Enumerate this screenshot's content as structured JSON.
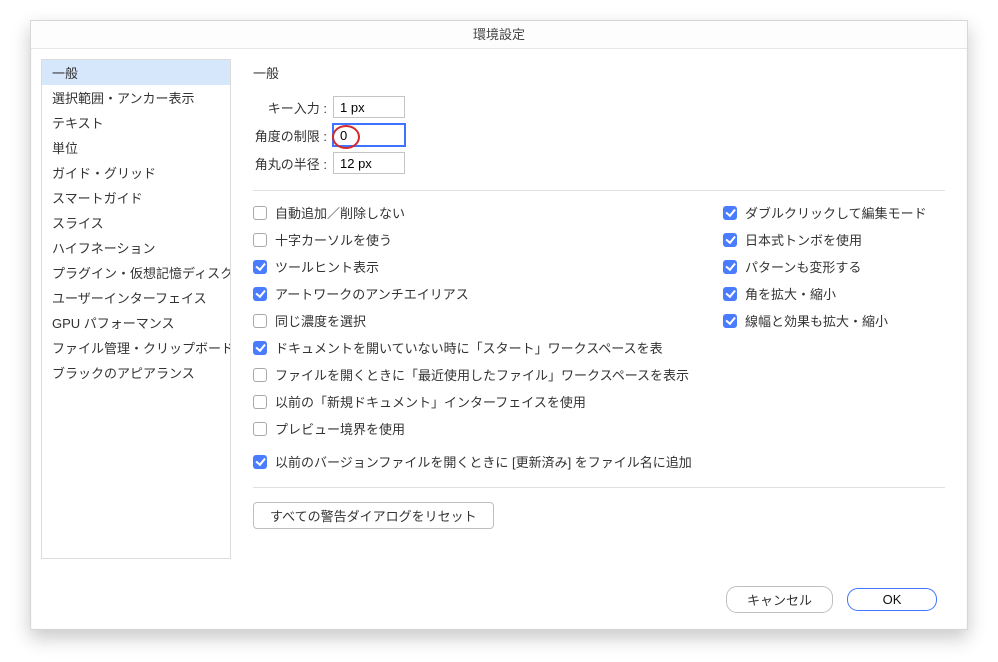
{
  "title": "環境設定",
  "sidebar": {
    "items": [
      {
        "label": "一般",
        "selected": true
      },
      {
        "label": "選択範囲・アンカー表示"
      },
      {
        "label": "テキスト"
      },
      {
        "label": "単位"
      },
      {
        "label": "ガイド・グリッド"
      },
      {
        "label": "スマートガイド"
      },
      {
        "label": "スライス"
      },
      {
        "label": "ハイフネーション"
      },
      {
        "label": "プラグイン・仮想記憶ディスク"
      },
      {
        "label": "ユーザーインターフェイス"
      },
      {
        "label": "GPU パフォーマンス"
      },
      {
        "label": "ファイル管理・クリップボード"
      },
      {
        "label": "ブラックのアピアランス"
      }
    ]
  },
  "panel": {
    "heading": "一般",
    "fields": {
      "key_input": {
        "label": "キー入力 :",
        "value": "1 px"
      },
      "angle_limit": {
        "label": "角度の制限 :",
        "value": "0",
        "highlight": true,
        "annotated": true
      },
      "corner_radius": {
        "label": "角丸の半径 :",
        "value": "12 px"
      }
    },
    "checks_left": [
      {
        "label": "自動追加／削除しない",
        "checked": false
      },
      {
        "label": "十字カーソルを使う",
        "checked": false
      },
      {
        "label": "ツールヒント表示",
        "checked": true
      },
      {
        "label": "アートワークのアンチエイリアス",
        "checked": true
      },
      {
        "label": "同じ濃度を選択",
        "checked": false
      },
      {
        "label": "ドキュメントを開いていない時に「スタート」ワークスペースを表",
        "checked": true
      },
      {
        "label": "ファイルを開くときに「最近使用したファイル」ワークスペースを表示",
        "checked": false
      },
      {
        "label": "以前の「新規ドキュメント」インターフェイスを使用",
        "checked": false
      },
      {
        "label": "プレビュー境界を使用",
        "checked": false
      }
    ],
    "checks_left_extra": {
      "label": "以前のバージョンファイルを開くときに [更新済み] をファイル名に追加",
      "checked": true
    },
    "checks_right": [
      {
        "label": "ダブルクリックして編集モード",
        "checked": true
      },
      {
        "label": "日本式トンボを使用",
        "checked": true
      },
      {
        "label": "パターンも変形する",
        "checked": true
      },
      {
        "label": "角を拡大・縮小",
        "checked": true
      },
      {
        "label": "線幅と効果も拡大・縮小",
        "checked": true
      }
    ],
    "reset_button": "すべての警告ダイアログをリセット"
  },
  "footer": {
    "cancel": "キャンセル",
    "ok": "OK"
  }
}
